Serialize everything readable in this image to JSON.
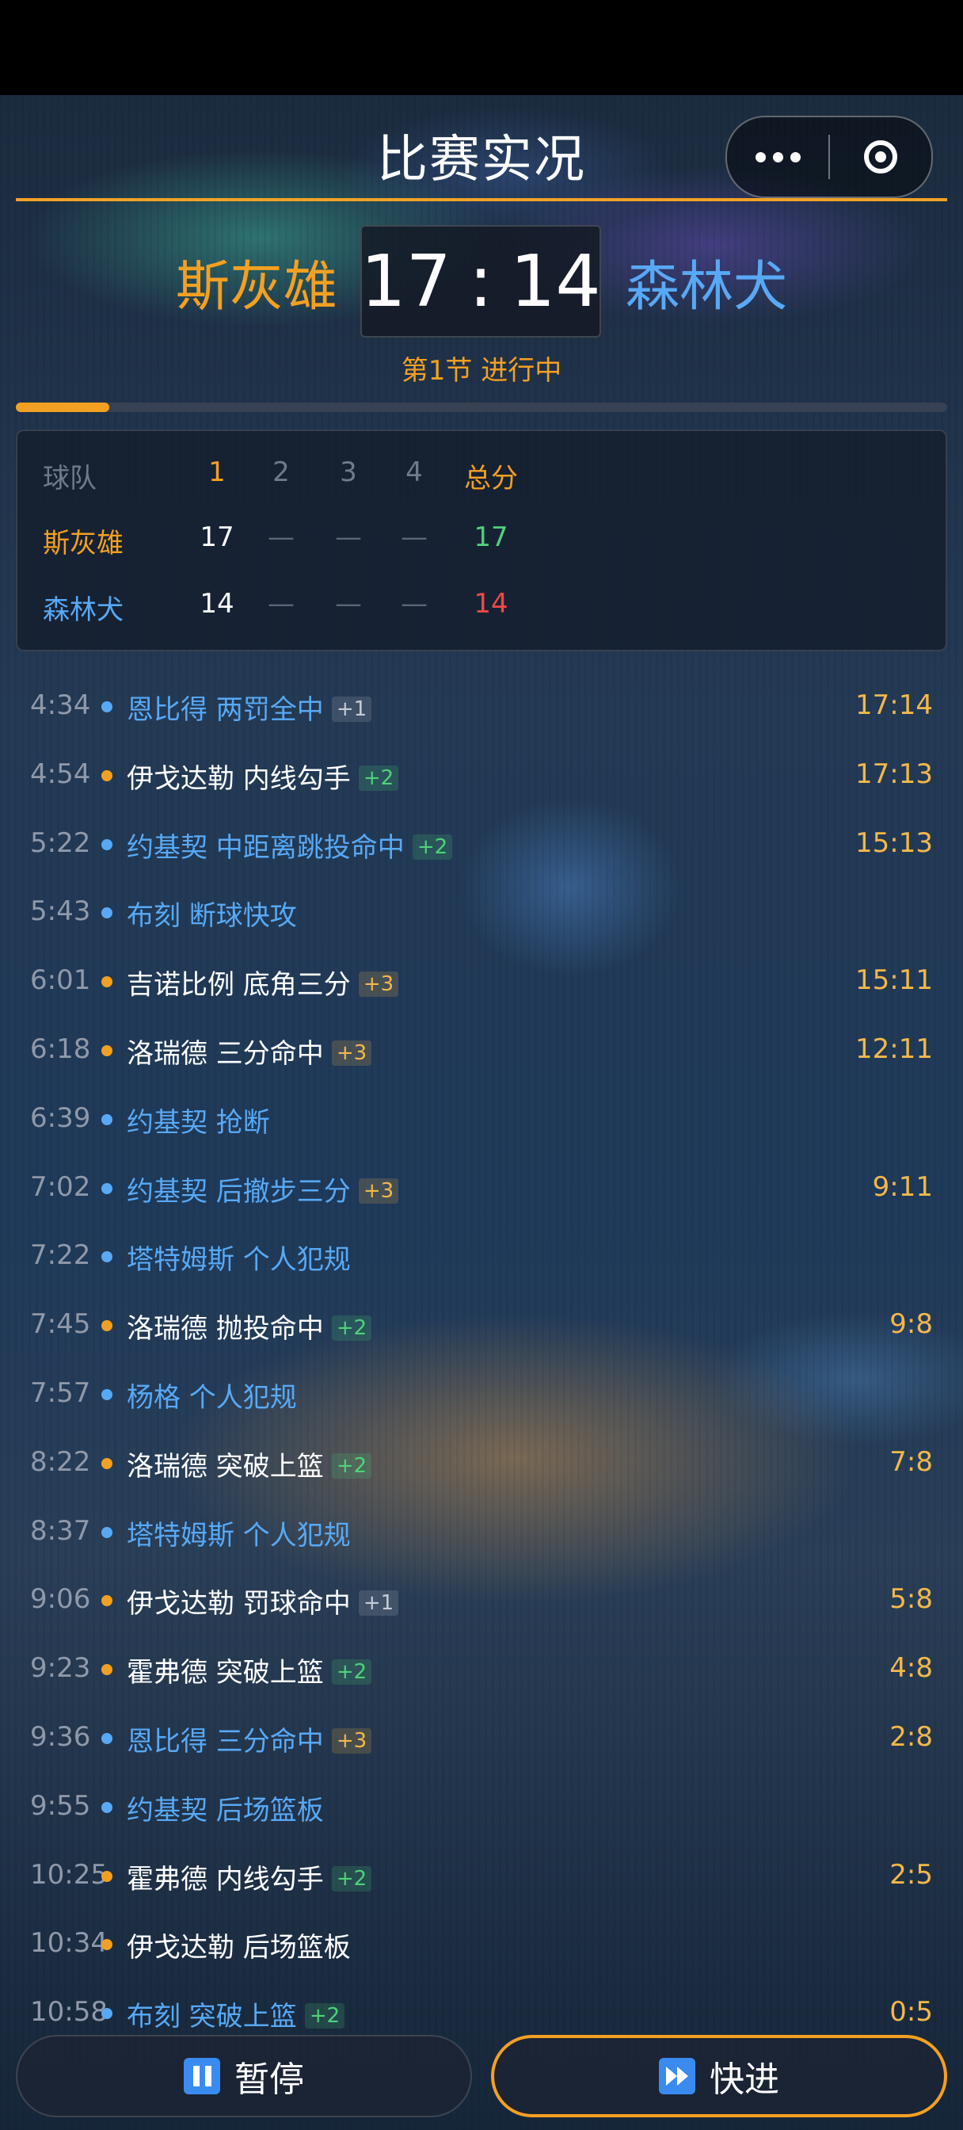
{
  "header": {
    "title": "比赛实况",
    "more_icon": "more-dots-icon",
    "close_icon": "target-circle-icon"
  },
  "scoreboard": {
    "home_team": "斯灰雄",
    "away_team": "森林犬",
    "home_score": "17",
    "separator": ":",
    "away_score": "14",
    "period_status": "第1节 进行中",
    "progress_fraction": 0.1,
    "colors": {
      "home": "#f3a022",
      "away": "#58a9f5",
      "accent": "#f0a226"
    }
  },
  "quarter_table": {
    "headers": [
      "球队",
      "1",
      "2",
      "3",
      "4",
      "总分"
    ],
    "rows": [
      {
        "team": "斯灰雄",
        "q1": "17",
        "q2": "—",
        "q3": "—",
        "q4": "—",
        "total": "17"
      },
      {
        "team": "森林犬",
        "q1": "14",
        "q2": "—",
        "q3": "—",
        "q4": "—",
        "total": "14"
      }
    ]
  },
  "events": [
    {
      "time": "4:34",
      "side": "away",
      "text": "恩比得 两罚全中",
      "pts": "+1",
      "score": "17:14"
    },
    {
      "time": "4:54",
      "side": "home",
      "text": "伊戈达勒 内线勾手",
      "pts": "+2",
      "score": "17:13"
    },
    {
      "time": "5:22",
      "side": "away",
      "text": "约基契 中距离跳投命中",
      "pts": "+2",
      "score": "15:13"
    },
    {
      "time": "5:43",
      "side": "away",
      "text": "布刻 断球快攻",
      "pts": "",
      "score": ""
    },
    {
      "time": "6:01",
      "side": "home",
      "text": "吉诺比例 底角三分",
      "pts": "+3",
      "score": "15:11"
    },
    {
      "time": "6:18",
      "side": "home",
      "text": "洛瑞德 三分命中",
      "pts": "+3",
      "score": "12:11"
    },
    {
      "time": "6:39",
      "side": "away",
      "text": "约基契 抢断",
      "pts": "",
      "score": ""
    },
    {
      "time": "7:02",
      "side": "away",
      "text": "约基契 后撤步三分",
      "pts": "+3",
      "score": "9:11"
    },
    {
      "time": "7:22",
      "side": "away",
      "text": "塔特姆斯 个人犯规",
      "pts": "",
      "score": ""
    },
    {
      "time": "7:45",
      "side": "home",
      "text": "洛瑞德 抛投命中",
      "pts": "+2",
      "score": "9:8"
    },
    {
      "time": "7:57",
      "side": "away",
      "text": "杨格 个人犯规",
      "pts": "",
      "score": ""
    },
    {
      "time": "8:22",
      "side": "home",
      "text": "洛瑞德 突破上篮",
      "pts": "+2",
      "score": "7:8"
    },
    {
      "time": "8:37",
      "side": "away",
      "text": "塔特姆斯 个人犯规",
      "pts": "",
      "score": ""
    },
    {
      "time": "9:06",
      "side": "home",
      "text": "伊戈达勒 罚球命中",
      "pts": "+1",
      "score": "5:8"
    },
    {
      "time": "9:23",
      "side": "home",
      "text": "霍弗德 突破上篮",
      "pts": "+2",
      "score": "4:8"
    },
    {
      "time": "9:36",
      "side": "away",
      "text": "恩比得 三分命中",
      "pts": "+3",
      "score": "2:8"
    },
    {
      "time": "9:55",
      "side": "away",
      "text": "约基契 后场篮板",
      "pts": "",
      "score": ""
    },
    {
      "time": "10:25",
      "side": "home",
      "text": "霍弗德 内线勾手",
      "pts": "+2",
      "score": "2:5"
    },
    {
      "time": "10:34",
      "side": "home",
      "text": "伊戈达勒 后场篮板",
      "pts": "",
      "score": ""
    },
    {
      "time": "10:58",
      "side": "away",
      "text": "布刻 突破上篮",
      "pts": "+2",
      "score": "0:5"
    }
  ],
  "controls": {
    "pause_label": "暂停",
    "pause_icon": "pause-icon",
    "fast_label": "快进",
    "fast_icon": "fast-forward-icon"
  }
}
